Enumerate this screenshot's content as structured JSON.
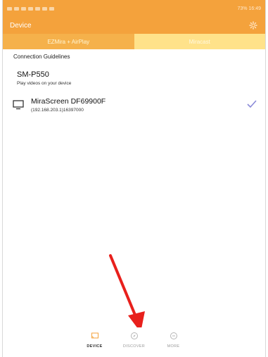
{
  "status_bar": {
    "right_text": "73% 16:49"
  },
  "app_bar": {
    "title": "Device"
  },
  "tabs": [
    {
      "label": "EZMira + AirPlay"
    },
    {
      "label": "Miracast"
    }
  ],
  "guidelines_label": "Connection Guidelines",
  "host_device": {
    "model": "SM-P550",
    "subtitle": "Play videos on your device"
  },
  "receiver": {
    "name": "MiraScreen DF69900F",
    "address": "(192.168.203.1)16397000",
    "selected": true
  },
  "bottom_nav": [
    {
      "label": "DEVICE",
      "icon": "cast-icon",
      "active": true
    },
    {
      "label": "DISCOVER",
      "icon": "compass-icon",
      "active": false
    },
    {
      "label": "MORE",
      "icon": "more-icon",
      "active": false
    }
  ],
  "colors": {
    "accent": "#f4a23c",
    "tab_active": "#f5b14b",
    "tab_inactive": "#ffe28a",
    "check": "#8a8ad8",
    "annotation_arrow": "#e8201c"
  }
}
